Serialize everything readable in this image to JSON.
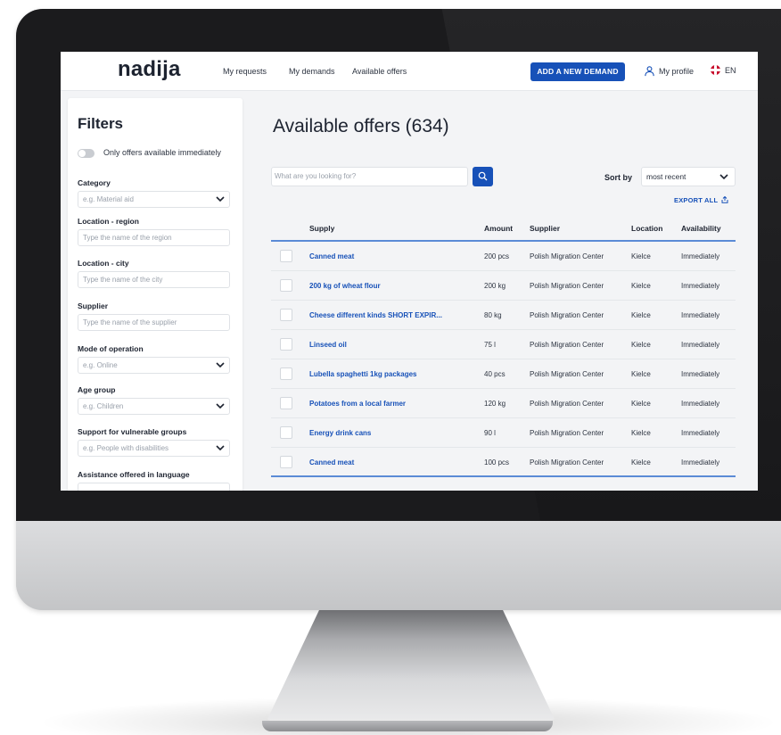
{
  "brand": {
    "logo": "nadija",
    "accent": "#1751b8"
  },
  "nav": {
    "links": [
      "My requests",
      "My demands",
      "Available offers"
    ],
    "add_demand": "ADD A NEW DEMAND",
    "profile": "My profile",
    "language": "EN"
  },
  "filters": {
    "title": "Filters",
    "toggle_label": "Only offers available immediately",
    "category": {
      "label": "Category",
      "placeholder": "e.g. Material aid"
    },
    "region": {
      "label": "Location - region",
      "placeholder": "Type the name of the region"
    },
    "city": {
      "label": "Location - city",
      "placeholder": "Type the name of the city"
    },
    "supplier": {
      "label": "Supplier",
      "placeholder": "Type the name of the supplier"
    },
    "mode": {
      "label": "Mode of operation",
      "placeholder": "e.g. Online"
    },
    "age": {
      "label": "Age group",
      "placeholder": "e.g. Children"
    },
    "vulnerable": {
      "label": "Support for vulnerable groups",
      "placeholder": "e.g. People with disabilities"
    },
    "language": {
      "label": "Assistance offered in language"
    }
  },
  "main": {
    "title": "Available offers (634)",
    "search_placeholder": "What are you looking for?",
    "sort_label": "Sort by",
    "sort_value": "most recent",
    "export": "EXPORT ALL"
  },
  "table": {
    "headers": {
      "supply": "Supply",
      "amount": "Amount",
      "supplier": "Supplier",
      "location": "Location",
      "availability": "Availability"
    },
    "rows": [
      {
        "supply": "Canned meat",
        "amount": "200 pcs",
        "supplier": "Polish Migration Center",
        "location": "Kielce",
        "availability": "Immediately"
      },
      {
        "supply": "200 kg of wheat flour",
        "amount": "200 kg",
        "supplier": "Polish Migration Center",
        "location": "Kielce",
        "availability": "Immediately"
      },
      {
        "supply": "Cheese different kinds SHORT EXPIR...",
        "amount": "80 kg",
        "supplier": "Polish Migration Center",
        "location": "Kielce",
        "availability": "Immediately"
      },
      {
        "supply": "Linseed oil",
        "amount": "75 l",
        "supplier": "Polish Migration Center",
        "location": "Kielce",
        "availability": "Immediately"
      },
      {
        "supply": "Lubella spaghetti 1kg packages",
        "amount": "40 pcs",
        "supplier": "Polish Migration Center",
        "location": "Kielce",
        "availability": "Immediately"
      },
      {
        "supply": "Potatoes from a local farmer",
        "amount": "120 kg",
        "supplier": "Polish Migration Center",
        "location": "Kielce",
        "availability": "Immediately"
      },
      {
        "supply": "Energy drink cans",
        "amount": "90 l",
        "supplier": "Polish Migration Center",
        "location": "Kielce",
        "availability": "Immediately"
      },
      {
        "supply": "Canned meat",
        "amount": "100 pcs",
        "supplier": "Polish Migration Center",
        "location": "Kielce",
        "availability": "Immediately"
      }
    ]
  }
}
